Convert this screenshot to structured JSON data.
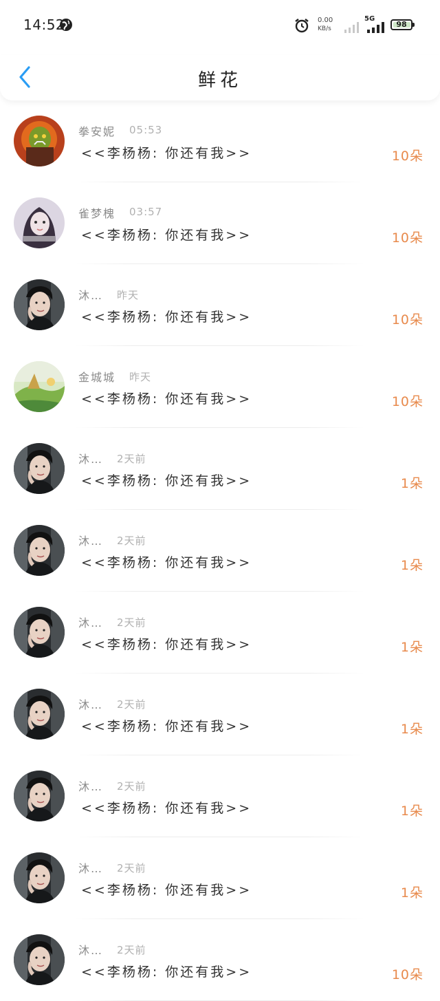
{
  "status_bar": {
    "time": "14:52",
    "net_speed_value": "0.00",
    "net_speed_unit": "KB/s",
    "network_type": "5G",
    "battery": "98"
  },
  "header": {
    "title": "鲜花"
  },
  "flowers": [
    {
      "name": "拳安妮",
      "time": "05:53",
      "message": "<<李杨杨: 你还有我>>",
      "count": "10朵",
      "avatar": "orc"
    },
    {
      "name": "雀梦槐",
      "time": "03:57",
      "message": "<<李杨杨: 你还有我>>",
      "count": "10朵",
      "avatar": "girl"
    },
    {
      "name": "沐…",
      "time": "昨天",
      "message": "<<李杨杨: 你还有我>>",
      "count": "10朵",
      "avatar": "man"
    },
    {
      "name": "金城城",
      "time": "昨天",
      "message": "<<李杨杨: 你还有我>>",
      "count": "10朵",
      "avatar": "landscape"
    },
    {
      "name": "沐…",
      "time": "2天前",
      "message": "<<李杨杨: 你还有我>>",
      "count": "1朵",
      "avatar": "man"
    },
    {
      "name": "沐…",
      "time": "2天前",
      "message": "<<李杨杨: 你还有我>>",
      "count": "1朵",
      "avatar": "man"
    },
    {
      "name": "沐…",
      "time": "2天前",
      "message": "<<李杨杨: 你还有我>>",
      "count": "1朵",
      "avatar": "man"
    },
    {
      "name": "沐…",
      "time": "2天前",
      "message": "<<李杨杨: 你还有我>>",
      "count": "1朵",
      "avatar": "man"
    },
    {
      "name": "沐…",
      "time": "2天前",
      "message": "<<李杨杨: 你还有我>>",
      "count": "1朵",
      "avatar": "man"
    },
    {
      "name": "沐…",
      "time": "2天前",
      "message": "<<李杨杨: 你还有我>>",
      "count": "1朵",
      "avatar": "man"
    },
    {
      "name": "沐…",
      "time": "2天前",
      "message": "<<李杨杨: 你还有我>>",
      "count": "10朵",
      "avatar": "man"
    }
  ],
  "colors": {
    "accent_back": "#2a9df4",
    "count": "#e88a4c"
  }
}
